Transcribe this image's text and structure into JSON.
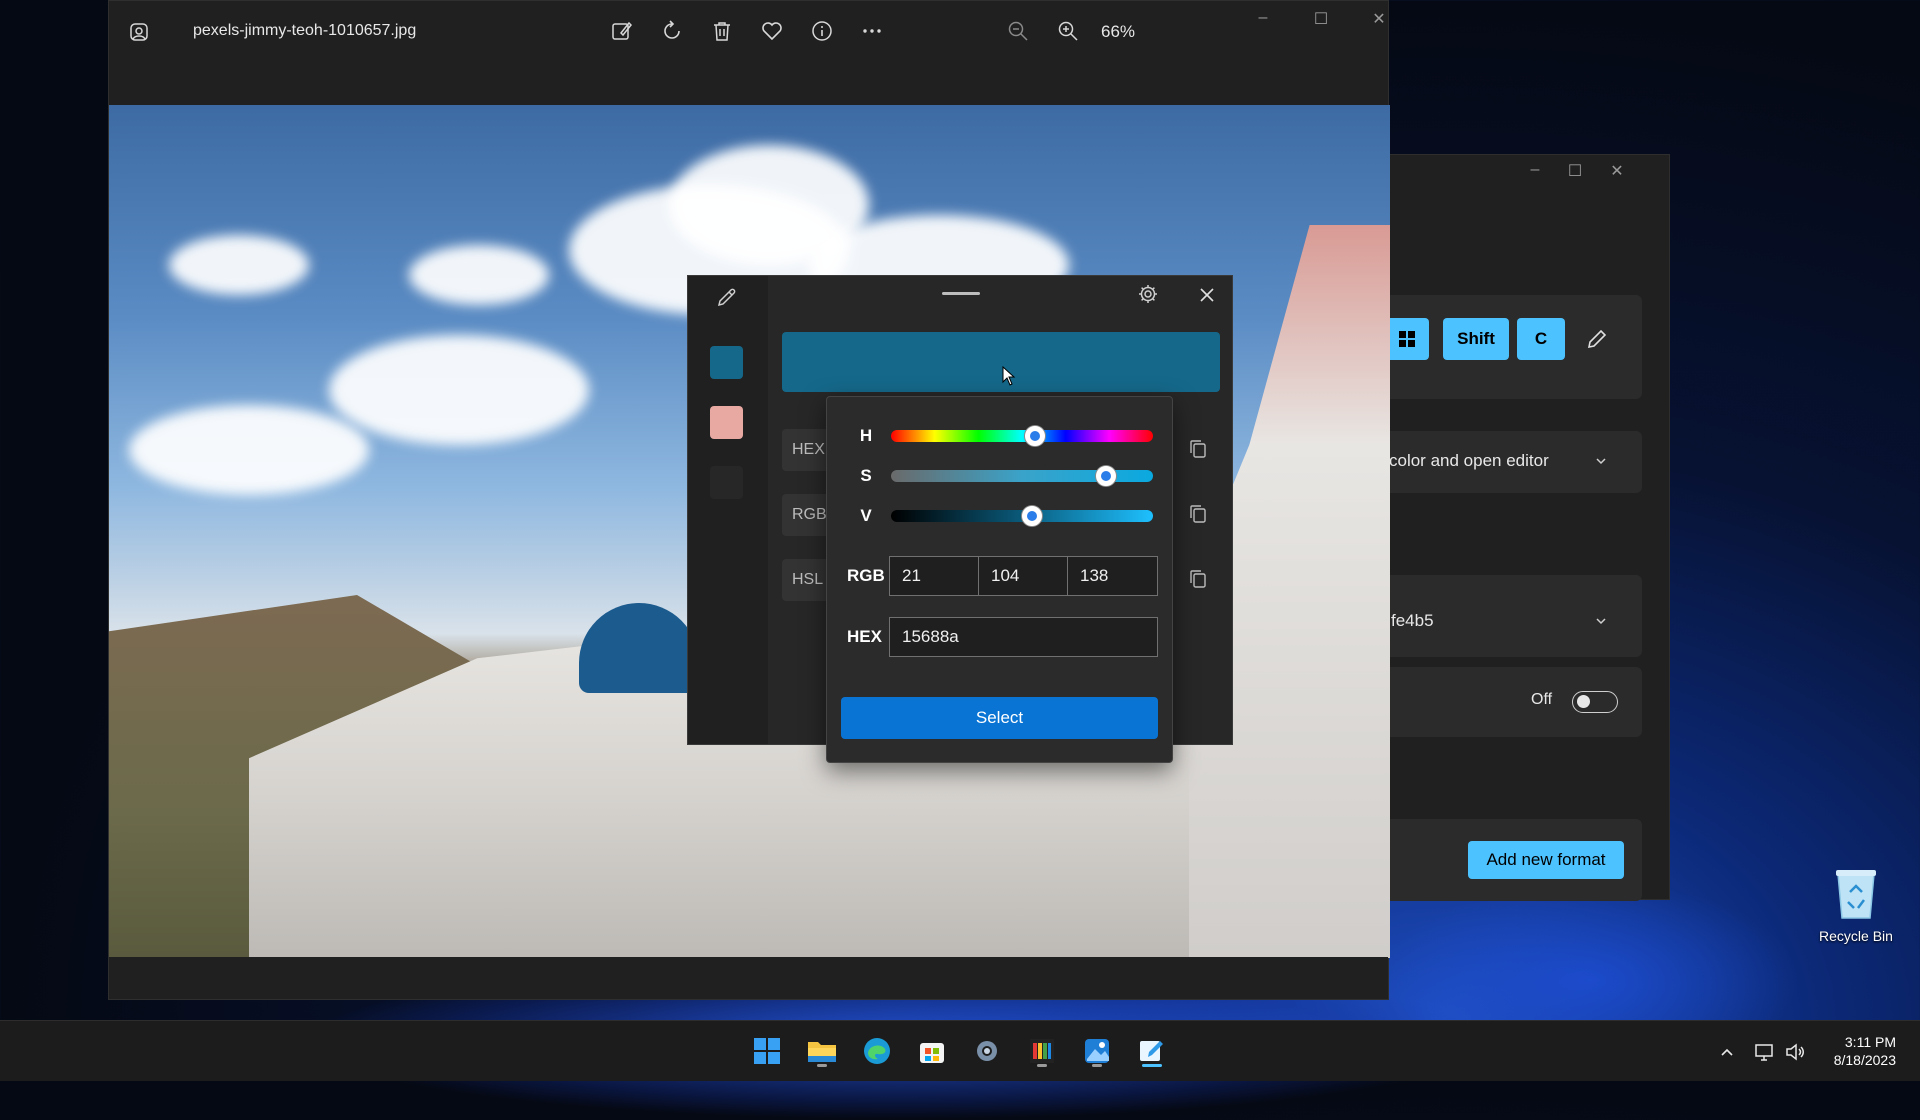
{
  "photos": {
    "filename": "pexels-jimmy-teoh-1010657.jpg",
    "zoom": "66%",
    "toolbar_icons": [
      "edit-image-icon",
      "rotate-icon",
      "delete-icon",
      "favorite-icon",
      "info-icon",
      "more-icon",
      "zoom-out-icon",
      "zoom-in-icon"
    ]
  },
  "settings": {
    "shortcut_keys": [
      "Shift",
      "C"
    ],
    "activation_behavior": "color and open editor",
    "default_format_partial": "fe4b5",
    "toggle_label": "Off",
    "add_format_label": "Add new format"
  },
  "picker": {
    "current_color": "#15688a",
    "history_colors": [
      "#15688a",
      "#e8a9a3",
      "#272727"
    ],
    "format_labels": [
      "HEX",
      "RGB",
      "HSL"
    ]
  },
  "editor": {
    "sliders": [
      {
        "label": "H",
        "value_fraction": 0.55
      },
      {
        "label": "S",
        "value_fraction": 0.82
      },
      {
        "label": "V",
        "value_fraction": 0.54
      }
    ],
    "rgb_label": "RGB",
    "rgb": [
      "21",
      "104",
      "138"
    ],
    "hex_label": "HEX",
    "hex": "15688a",
    "select_label": "Select"
  },
  "desktop": {
    "recycle_bin_label": "Recycle Bin"
  },
  "taskbar": {
    "apps": [
      "start-icon",
      "file-explorer-icon",
      "edge-icon",
      "store-icon",
      "settings-icon",
      "color-app-icon",
      "photos-icon",
      "color-picker-icon"
    ],
    "time": "3:11 PM",
    "date": "8/18/2023"
  },
  "colors": {
    "accent": "#4cc2ff",
    "select_button": "#0a74d4",
    "picked": "#15688a"
  }
}
